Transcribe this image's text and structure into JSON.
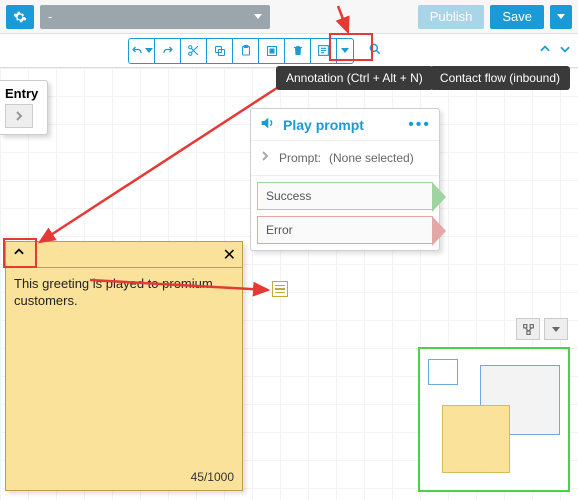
{
  "topbar": {
    "name_dropdown": "-",
    "publish_label": "Publish",
    "save_label": "Save"
  },
  "tooltip": {
    "annotation": "Annotation (Ctrl + Alt + N)"
  },
  "tag": {
    "contact_flow": "Contact flow (inbound)"
  },
  "entry": {
    "label": "Entry"
  },
  "play_prompt": {
    "title": "Play prompt",
    "prompt_label": "Prompt:",
    "prompt_value": "(None selected)",
    "branch_success": "Success",
    "branch_error": "Error"
  },
  "note": {
    "body": "This greeting is played to premium customers.",
    "counter": "45/1000"
  },
  "colors": {
    "accent": "#1a9bd7",
    "highlight": "#e53935",
    "note_bg": "#fbe29b",
    "minimap_border": "#4cd04c"
  }
}
